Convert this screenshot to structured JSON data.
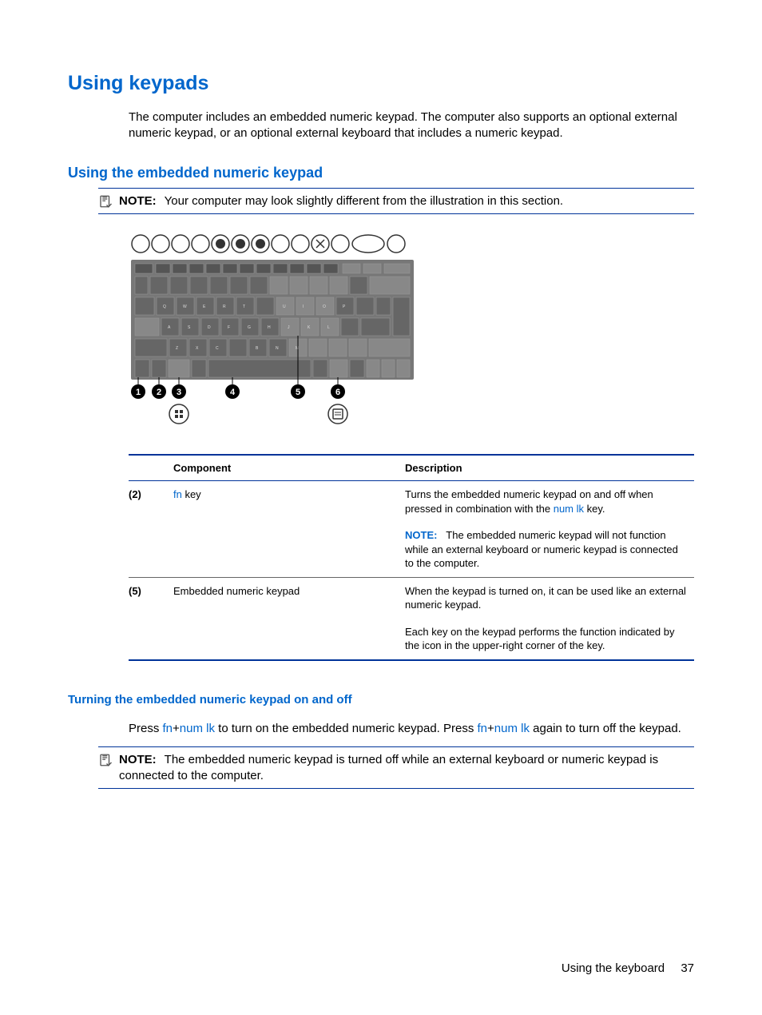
{
  "heading1": "Using keypads",
  "intro": "The computer includes an embedded numeric keypad. The computer also supports an optional external numeric keypad, or an optional external keyboard that includes a numeric keypad.",
  "heading2": "Using the embedded numeric keypad",
  "note1_label": "NOTE:",
  "note1_text": "Your computer may look slightly different from the illustration in this section.",
  "table": {
    "headers": {
      "component": "Component",
      "description": "Description"
    },
    "row1": {
      "num": "(2)",
      "comp_blue": "fn",
      "comp_rest": " key",
      "desc1_a": "Turns the embedded numeric keypad on and off when pressed in combination with the ",
      "desc1_link": "num lk",
      "desc1_b": " key.",
      "note_label": "NOTE:",
      "note_text": "The embedded numeric keypad will not function while an external keyboard or numeric keypad is connected to the computer."
    },
    "row2": {
      "num": "(5)",
      "comp": "Embedded numeric keypad",
      "desc1": "When the keypad is turned on, it can be used like an external numeric keypad.",
      "desc2": "Each key on the keypad performs the function indicated by the icon in the upper-right corner of the key."
    }
  },
  "heading3": "Turning the embedded numeric keypad on and off",
  "body3_a": "Press ",
  "body3_fn1": "fn",
  "body3_plus1": "+",
  "body3_numlk1": "num lk",
  "body3_b": " to turn on the embedded numeric keypad. Press ",
  "body3_fn2": "fn",
  "body3_plus2": "+",
  "body3_numlk2": "num lk",
  "body3_c": " again to turn off the keypad.",
  "note2_label": "NOTE:",
  "note2_text": "The embedded numeric keypad is turned off while an external keyboard or numeric keypad is connected to the computer.",
  "footer_text": "Using the keyboard",
  "footer_page": "37"
}
